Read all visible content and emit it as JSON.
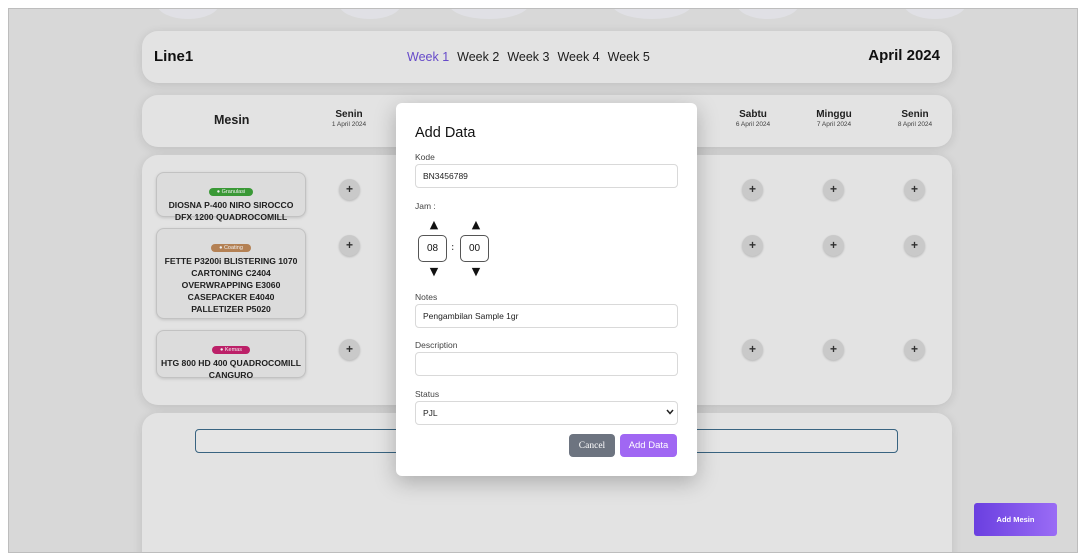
{
  "header": {
    "line": "Line1",
    "weeks": [
      "Week 1",
      "Week 2",
      "Week 3",
      "Week 4",
      "Week 5"
    ],
    "active_week": "Week 1",
    "month": "April 2024",
    "accent": "#6d4fd6"
  },
  "table": {
    "mesin_label": "Mesin",
    "days": [
      {
        "name": "Senin",
        "date": "1 April 2024"
      },
      {
        "name": "Sabtu",
        "date": "6 April 2024"
      },
      {
        "name": "Minggu",
        "date": "7 April 2024"
      },
      {
        "name": "Senin",
        "date": "8 April 2024"
      }
    ],
    "plus_symbol": "+",
    "machines": [
      {
        "tag": "● Granulasi",
        "tag_color": "#3ea33a",
        "name": "DIOSNA P-400 NIRO SIROCCO DFX 1200 QUADROCOMILL"
      },
      {
        "tag": "● Coating",
        "tag_color": "#c08a5a",
        "name": "FETTE P3200i BLISTERING 1070 CARTONING C2404 OVERWRAPPING E3060 CASEPACKER E4040 PALLETIZER P5020"
      },
      {
        "tag": "● Kemas",
        "tag_color": "#c8236f",
        "name": "HTG 800 HD 400 QUADROCOMILL CANGURO"
      }
    ]
  },
  "add_mesin_label": "Add Mesin",
  "modal": {
    "title": "Add Data",
    "kode_label": "Kode",
    "kode_value": "BN3456789",
    "jam_label": "Jam :",
    "hour": "08",
    "minute": "00",
    "up_arrow": "▲",
    "down_arrow": "▼",
    "colon": ":",
    "notes_label": "Notes",
    "notes_value": "Pengambilan Sample 1gr",
    "description_label": "Description",
    "description_value": "",
    "status_label": "Status",
    "status_value": "PJL",
    "cancel_label": "Cancel",
    "add_label": "Add Data"
  }
}
